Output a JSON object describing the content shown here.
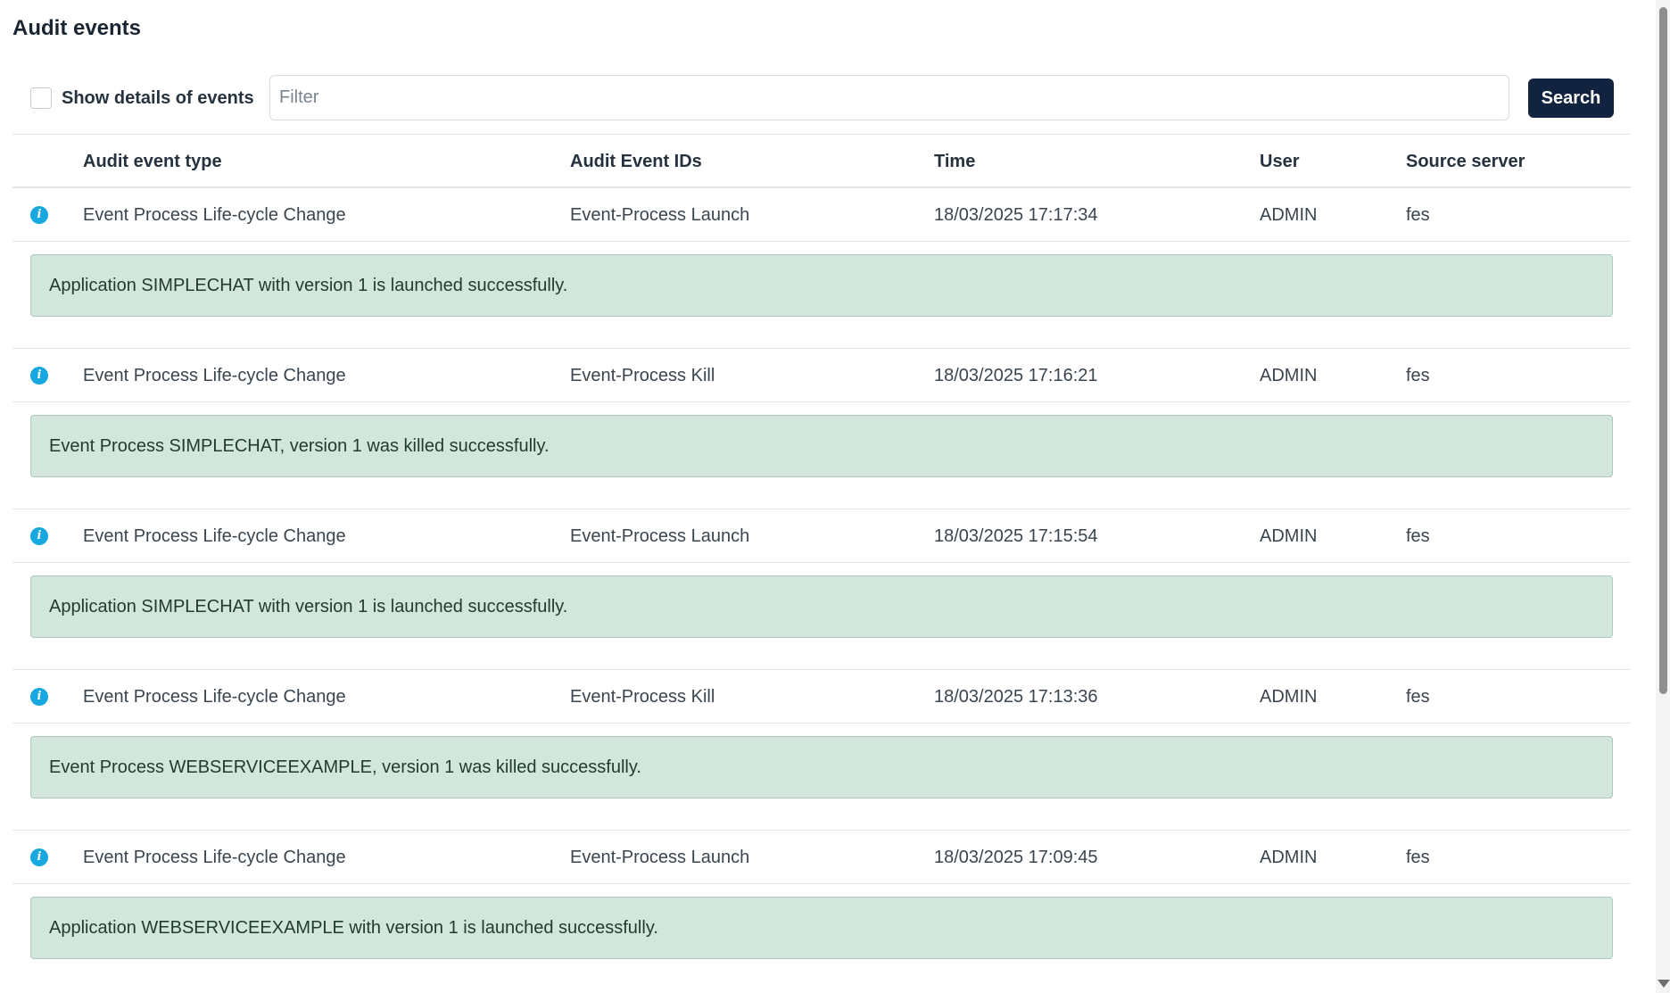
{
  "page": {
    "title": "Audit events"
  },
  "toolbar": {
    "show_details_label": "Show details of events",
    "show_details_checked": false,
    "filter_placeholder": "Filter",
    "filter_value": "",
    "search_label": "Search"
  },
  "table": {
    "headers": [
      "Audit event type",
      "Audit Event IDs",
      "Time",
      "User",
      "Source server"
    ],
    "rows": [
      {
        "type": "Event Process Life-cycle Change",
        "ids": "Event-Process Launch",
        "time": "18/03/2025 17:17:34",
        "user": "ADMIN",
        "source": "fes",
        "detail": "Application SIMPLECHAT with version 1 is launched successfully."
      },
      {
        "type": "Event Process Life-cycle Change",
        "ids": "Event-Process Kill",
        "time": "18/03/2025 17:16:21",
        "user": "ADMIN",
        "source": "fes",
        "detail": "Event Process SIMPLECHAT, version 1 was killed successfully."
      },
      {
        "type": "Event Process Life-cycle Change",
        "ids": "Event-Process Launch",
        "time": "18/03/2025 17:15:54",
        "user": "ADMIN",
        "source": "fes",
        "detail": "Application SIMPLECHAT with version 1 is launched successfully."
      },
      {
        "type": "Event Process Life-cycle Change",
        "ids": "Event-Process Kill",
        "time": "18/03/2025 17:13:36",
        "user": "ADMIN",
        "source": "fes",
        "detail": "Event Process WEBSERVICEEXAMPLE, version 1 was killed successfully."
      },
      {
        "type": "Event Process Life-cycle Change",
        "ids": "Event-Process Launch",
        "time": "18/03/2025 17:09:45",
        "user": "ADMIN",
        "source": "fes",
        "detail": "Application WEBSERVICEEXAMPLE with version 1 is launched successfully."
      }
    ]
  },
  "icons": {
    "row_status": "info-icon",
    "info_glyph": "i"
  },
  "colors": {
    "search_button": "#12233f",
    "info_icon": "#17a8e2",
    "detail_background": "#d2e6dc",
    "detail_border": "#a7ccb9"
  }
}
